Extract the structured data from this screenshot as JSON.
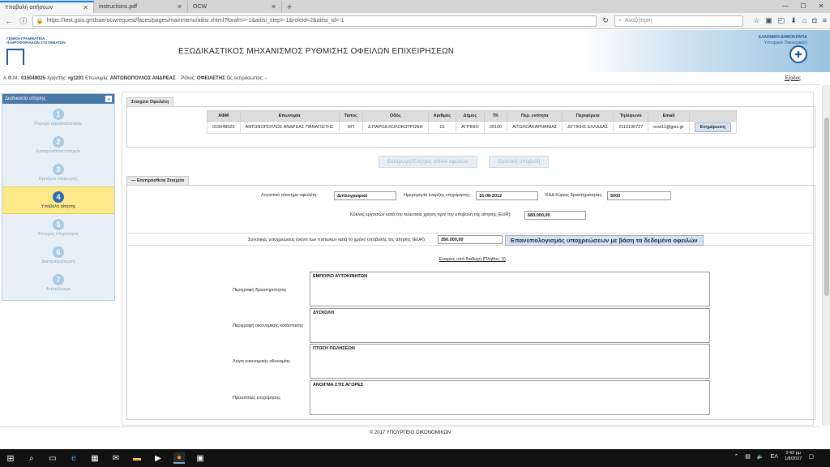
{
  "browser": {
    "tabs": [
      {
        "label": "Υποβολή αιτήσεων",
        "active": true
      },
      {
        "label": "instructions.pdf",
        "active": false
      },
      {
        "label": "OCW",
        "active": false
      }
    ],
    "url": "https://test.gsis.gr/dsae/ocwrequest/faces/pages/mainmenu/aitisi.xhtml?forafm=-1&aitisi_step=-1&roleid=2&aitisi_id=-1",
    "search_placeholder": "Αναζήτηση"
  },
  "header": {
    "org_line1": "ΓΕΝΙΚΗ ΓΡΑΜΜΑΤΕΙΑ",
    "org_line2": "ΠΛΗΡΟΦΟΡΙΑΚΩΝ ΣΥΣΤΗΜΑΤΩΝ",
    "title": "ΕΞΩΔΙΚΑΣΤΙΚΟΣ ΜΗΧΑΝΙΣΜΟΣ ΡΥΘΜΙΣΗΣ ΟΦΕΙΛΩΝ ΕΠΙΧΕΙΡΗΣΕΩΝ",
    "gov_line1": "ΕΛΛΗΝΙΚΗ ΔΗΜΟΚΡΑΤΙΑ",
    "gov_line2": "Υπουργείο Οικονομικών"
  },
  "userbar": {
    "afm_label": "Α.Φ.Μ.:",
    "afm": "015049025",
    "user_label": "Χρήστης:",
    "user": "rg1201",
    "name_label": "Επωνυμία:",
    "name": "ΑΝΤΩΝΟΠΟΥΛΟΣ ΑΝΔΡΕΑΣ",
    "role_label": "Ρόλος:",
    "role": "ΟΦΕΙΛΕΤΗΣ",
    "as_rep_label": "Ως εκπρόσωπος:",
    "as_rep": "-",
    "exit": "Έξοδος"
  },
  "sidebar": {
    "title": "Διαδικασία αίτησης",
    "steps": [
      {
        "num": "1",
        "label": "Παροχή εξουσιοδότησης"
      },
      {
        "num": "2",
        "label": "Επιπρόσθετα στοιχεία"
      },
      {
        "num": "3",
        "label": "Κριτήρια υπαγωγής"
      },
      {
        "num": "4",
        "label": "Υποβολή αίτησης"
      },
      {
        "num": "5",
        "label": "Έλεγχος πληρότητας"
      },
      {
        "num": "6",
        "label": "Διαπραγμάτευση"
      },
      {
        "num": "7",
        "label": "Αποτέλεσμα"
      }
    ],
    "active_step": 4
  },
  "debtor": {
    "section_title": "Στοιχεία Οφειλέτη",
    "headers": [
      "ΑΦΜ",
      "Επωνυμία",
      "Τύπος",
      "Οδός",
      "Αριθμός",
      "Δήμος",
      "ΤΚ",
      "Περ. ενότητα",
      "Περιφέρεια",
      "Τηλέφωνο",
      "Email"
    ],
    "row": [
      "015049025",
      "ΑΝΤΩΝΟΠΟΥΛΟΣ ΑΝΔΡΕΑΣ ΠΑΝΑΓΙΩΤΗΣ",
      "ΦΠ",
      "Δ ΠΑΡΟΔ ΚΟΛΟΚΟΤΡΩΝΗ",
      "15",
      "ΑΓΡΙΝΙΟ",
      "30100",
      "ΑΙΤΩΛΟΑΚΑΡΝΑΝΙΑΣ",
      "ΔΥΤΙΚΗΣ ΕΛΛΑΔΑΣ",
      "2110196727",
      "ocw11@gsis.gr"
    ],
    "update_button": "Ενημέρωση"
  },
  "actions": {
    "import_debts": "Εισαγωγή/Έλεγχος online οφειλών",
    "final_submit": "Οριστική υποβολή"
  },
  "additional": {
    "section_title": "— Επιπρόσθετα Στοιχεία",
    "accounting_label": "Λογιστικό σύστημα οφειλέτη:",
    "accounting_value": "Διπλογραφικό",
    "start_date_label": "Ημερομηνία έναρξης επιχείρησης:",
    "start_date_value": "16-08-2012",
    "kad_label": "ΚΑΔ Κύριας δραστηριότητας:",
    "kad_value": "5000",
    "turnover_label": "Κύκλος εργασιών κατά την τελευταία χρήση πριν την υποβολή της αίτησης (EUR):",
    "turnover_value": "680.000,00",
    "total_obligations_label": "Συνολικές υποχρεώσεις έναντι των πιστωτών κατά το χρόνο υποβολής της αίτησης (EUR):",
    "total_obligations_value": "350.000,00",
    "recalc_button": "Επανυπολογισμός υποχρεώσεων με βάση τα δεδομένα οφειλών",
    "branches_link": "Εταιρίες υπό διαδοχή (Πλήθος: 0)",
    "activity_label": "Περιγραφή δραστηριότητας",
    "activity_value": "ΕΜΠΟΡΙΟ ΑΥΤΟΚΙΝΗΤΩΝ",
    "financial_label": "Περιγραφή οικονομικής κατάστασης",
    "financial_value": "ΔΥΣΚΟΛΗ",
    "reasons_label": "Λόγοι οικονομικής αδυναμίας",
    "reasons_value": "ΠΤΩΣΗ ΠΩΛΗΣΕΩΝ",
    "prospects_label": "Προοπτικές επιχείρησης",
    "prospects_value": "ΑΝΟΙΓΜΑ ΣΤΙΣ ΑΓΟΡΕΣ"
  },
  "footer": "© 2017 ΥΠΟΥΡΓΕΙΟ ΟΙΚΟΝΟΜΙΚΩΝ",
  "taskbar": {
    "time": "2:42 μμ",
    "date": "1/8/2017"
  }
}
